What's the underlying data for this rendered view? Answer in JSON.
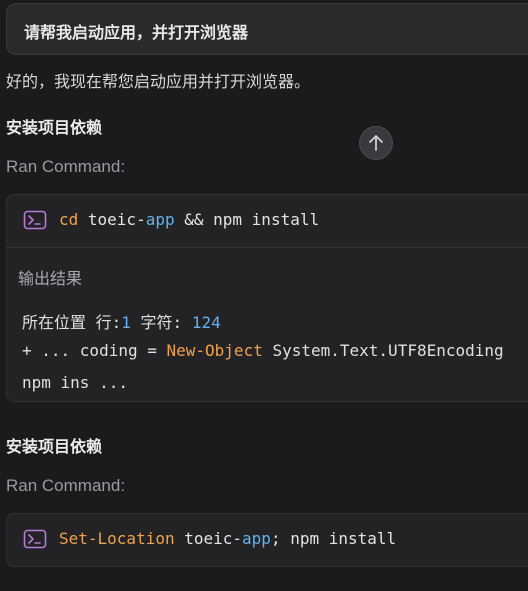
{
  "user_message": "请帮我启动应用，并打开浏览器",
  "assistant_reply": "好的，我现在帮您启动应用并打开浏览器。",
  "steps": [
    {
      "heading": "安装项目依赖",
      "ran_label": "Ran Command:",
      "command": {
        "kw": "cd",
        "p1": " toeic-",
        "p2": "app",
        "p3": " && npm install"
      },
      "output_label": "输出结果",
      "output": {
        "l1_text": "所在位置 行:",
        "l1_row": "1",
        "l1_mid": " 字符: ",
        "l1_col": "124",
        "l2_pre": "+ ... coding = ",
        "l2_obj": "New-Object",
        "l2_post": " System.Text.UTF8Encoding",
        "l3": "npm ins ..."
      }
    },
    {
      "heading": "安装项目依赖",
      "ran_label": "Ran Command:",
      "command": {
        "kw": "Set-Location",
        "p1": " toeic-",
        "p2": "app",
        "p3": "; npm install"
      }
    }
  ],
  "icons": {
    "scroll": "arrow-up-icon",
    "terminal": "terminal-icon"
  },
  "colors": {
    "accent_purple": "#b57bd6",
    "keyword_orange": "#f0a24a",
    "number_blue": "#5fb3f0"
  }
}
